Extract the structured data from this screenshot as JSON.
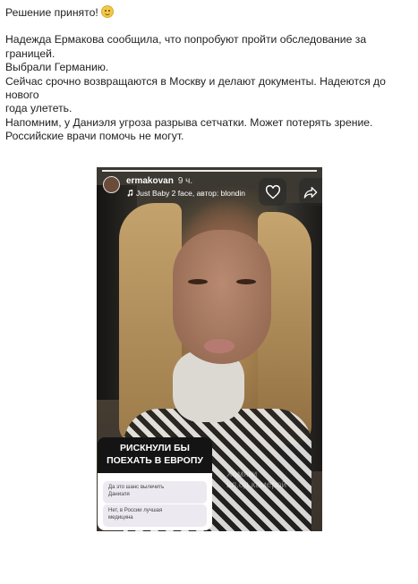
{
  "post": {
    "line1": "Решение принято!",
    "line2": "Надежда Ермакова сообщила, что попробуют пройти обследование за границей.",
    "line3": "Выбрали Германию.",
    "line4": "Сейчас срочно возвращаются в Москву и делают документы. Надеются до нового",
    "line5": "года улететь.",
    "line6": "Напомним, у Даниэля угроза разрыва сетчатки. Может потерять зрение.",
    "line7": "Российские врачи помочь не могут."
  },
  "story": {
    "username": "ermakovan",
    "time": "9 ч.",
    "music": "Just Baby 2 face, автор: blondin",
    "poll": {
      "question_line1": "РИСКНУЛИ БЫ",
      "question_line2": "ПОЕХАТЬ В ЕВРОПУ",
      "option1_line1": "Да это шанс вылечить",
      "option1_line2": "Даниэля",
      "option2_line1": "Нет, в России лучшая",
      "option2_line2": "медицина"
    },
    "watermark_line1": "Хомяки",
    "watermark_line2": "ьл.од камерой"
  },
  "icons": {
    "emoji": "slightly-smiling-face-icon",
    "like": "heart-icon",
    "share": "share-arrow-icon",
    "music": "music-note-icon"
  }
}
